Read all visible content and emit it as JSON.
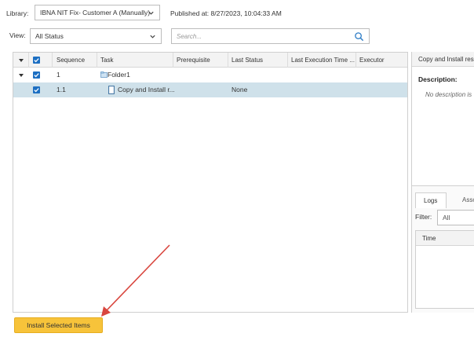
{
  "header": {
    "library_label": "Library:",
    "library_value": "IBNA NIT Fix- Customer A (Manually)",
    "published": "Published at: 8/27/2023, 10:04:33 AM",
    "view_label": "View:",
    "view_value": "All Status",
    "search_placeholder": "Search..."
  },
  "grid": {
    "columns": [
      "Sequence",
      "Task",
      "Prerequisite",
      "Last Status",
      "Last Execution Time ...",
      "Executor"
    ],
    "rows": [
      {
        "sequence": "1",
        "task": "Folder1",
        "prerequisite": "",
        "last_status": "",
        "last_execution_time": "",
        "executor": ""
      },
      {
        "sequence": "1.1",
        "task": "Copy and Install r...",
        "prerequisite": "",
        "last_status": "None",
        "last_execution_time": "",
        "executor": ""
      }
    ]
  },
  "details": {
    "title": "Copy and Install res",
    "description_label": "Description:",
    "description_value": "No description is",
    "tabs": [
      "Logs",
      "Associ"
    ],
    "filter_label": "Filter:",
    "filter_value": "All",
    "time_column": "Time"
  },
  "footer": {
    "install_button": "Install Selected Items"
  },
  "colors": {
    "accent_button": "#f7c33a",
    "checkbox": "#1d6fc2",
    "selected_row": "#cfe1ea",
    "annotation_arrow": "#d9463e"
  }
}
